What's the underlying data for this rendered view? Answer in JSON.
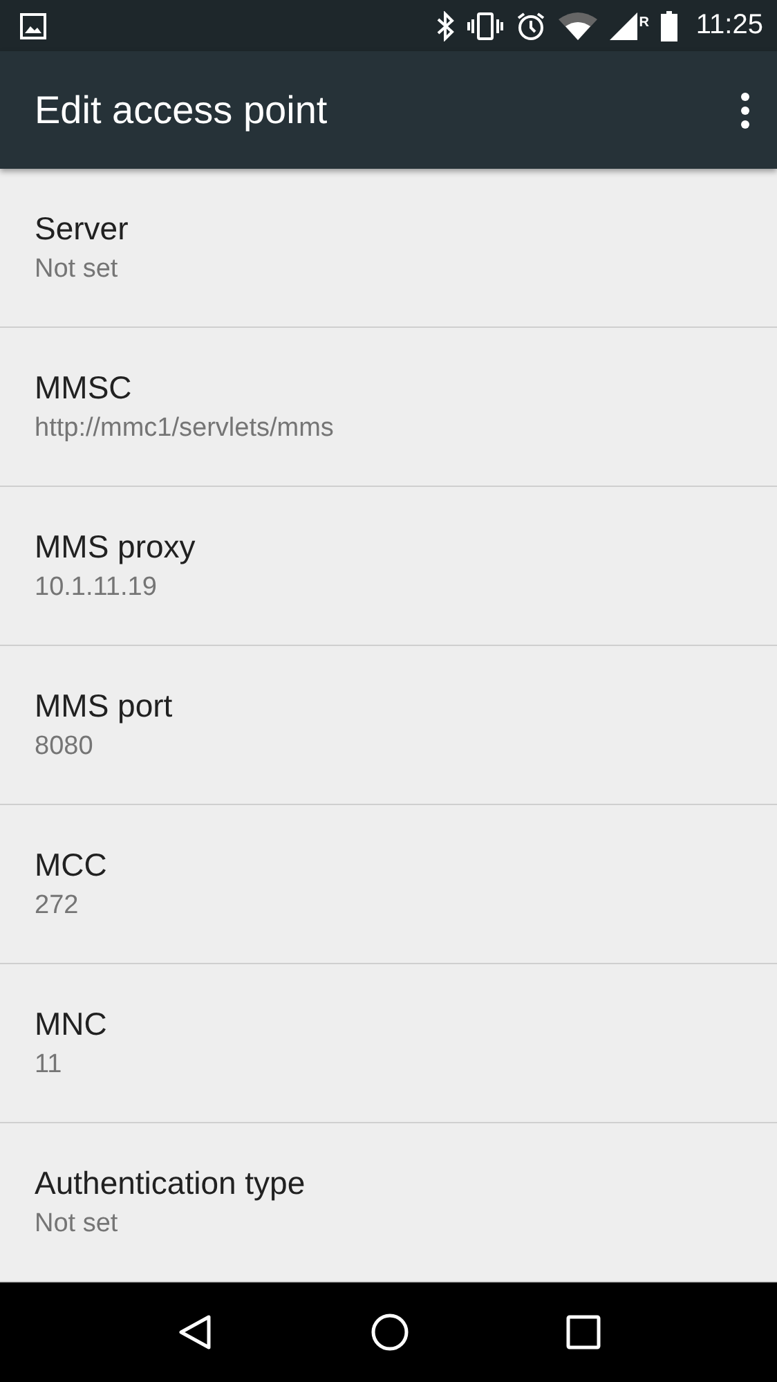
{
  "status_bar": {
    "roaming": "R",
    "time": "11:25"
  },
  "toolbar": {
    "title": "Edit access point"
  },
  "settings": [
    {
      "title": "Server",
      "summary": "Not set"
    },
    {
      "title": "MMSC",
      "summary": "http://mmc1/servlets/mms"
    },
    {
      "title": "MMS proxy",
      "summary": "10.1.11.19"
    },
    {
      "title": "MMS port",
      "summary": "8080"
    },
    {
      "title": "MCC",
      "summary": "272"
    },
    {
      "title": "MNC",
      "summary": "11"
    },
    {
      "title": "Authentication type",
      "summary": "Not set"
    }
  ]
}
